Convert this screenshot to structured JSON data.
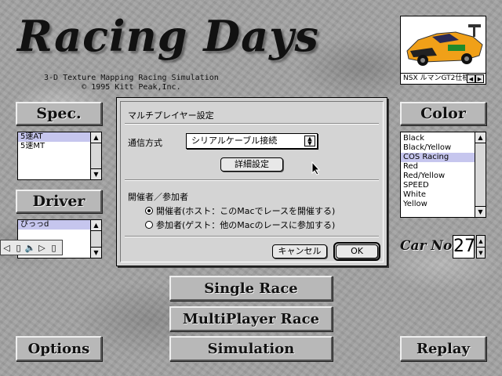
{
  "logo": {
    "title": "Racing Days",
    "subtitle_line1": "3-D Texture Mapping Racing Simulation",
    "subtitle_line2": "© 1995 Kitt Peak,Inc."
  },
  "spec": {
    "header": "Spec.",
    "items": [
      "5速AT",
      "5速MT"
    ],
    "selected_index": 0
  },
  "driver": {
    "header": "Driver",
    "items": [
      "ぴっっd"
    ],
    "selected_index": 0
  },
  "color": {
    "header": "Color",
    "items": [
      "Black",
      "Black/Yellow",
      "COS Racing",
      "Red",
      "Red/Yellow",
      "SPEED",
      "White",
      "Yellow"
    ],
    "selected_index": 2
  },
  "car": {
    "caption": "NSX ルマンGT2仕様",
    "number_label": "Car No.",
    "number": "27"
  },
  "dialog": {
    "title": "マルチプレイヤー設定",
    "comm_label": "通信方式",
    "comm_value": "シリアルケーブル接続",
    "detail_button": "詳細設定",
    "role_label": "開催者／参加者",
    "host_option": "開催者(ホスト：このMacでレースを開催する)",
    "guest_option": "参加者(ゲスト：他のMacのレースに参加する)",
    "selected_role": "host",
    "cancel_button": "キャンセル",
    "ok_button": "OK"
  },
  "buttons": {
    "single_race": "Single Race",
    "multiplayer_race": "MultiPlayer Race",
    "simulation": "Simulation",
    "options": "Options",
    "replay": "Replay"
  },
  "colors": {
    "list_selection": "#c6c6ee",
    "car_body": "#f0a018",
    "panel": "#b8b8b8"
  }
}
